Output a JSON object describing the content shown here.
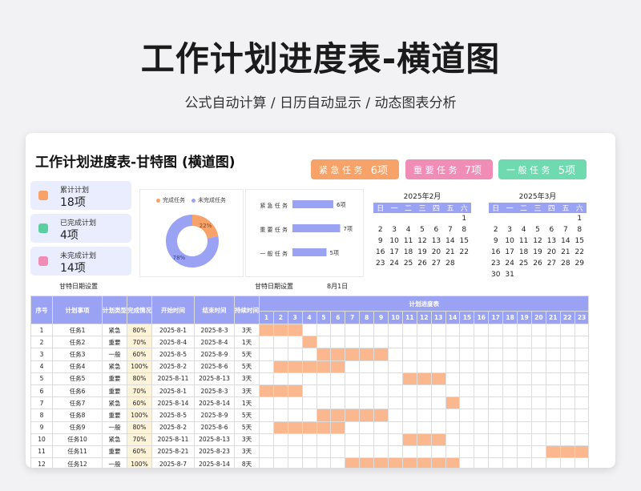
{
  "hero": {
    "title": "工作计划进度表-横道图",
    "subtitle": "公式自动计算 /  日历自动显示  /  动态图表分析"
  },
  "sheet": {
    "title": "工作计划进度表-甘特图 (横道图)"
  },
  "priority_pills": [
    {
      "label": "紧 急 任 务",
      "value": "6项",
      "color": "#f7a268"
    },
    {
      "label": "重 要 任 务",
      "value": "7项",
      "color": "#ef8db6"
    },
    {
      "label": "一 般 任 务",
      "value": "5项",
      "color": "#6fd9b0"
    }
  ],
  "stats": [
    {
      "label": "累计计划",
      "value": "18项",
      "icon": "calendar-icon",
      "color": "#f7a268"
    },
    {
      "label": "已完成计划",
      "value": "4项",
      "icon": "check-icon",
      "color": "#5ccfa0"
    },
    {
      "label": "未完成计划",
      "value": "14项",
      "icon": "pending-icon",
      "color": "#ef8db6"
    }
  ],
  "donut": {
    "legend": [
      "完成任务",
      "未完成任务"
    ],
    "colors": [
      "#f7a268",
      "#9aa2f4"
    ],
    "values": [
      22,
      78
    ],
    "labels": [
      "22%",
      "78%"
    ]
  },
  "bar_panel": {
    "categories": [
      "紧急任务",
      "重要任务",
      "一般任务"
    ],
    "category_labels": [
      "紧 急 任 务",
      "重 要 任 务",
      "一 般 任 务"
    ],
    "values": [
      6,
      7,
      5
    ],
    "value_labels": [
      "6项",
      "7项",
      "5项"
    ],
    "color": "#9aa2f4"
  },
  "calendars": [
    {
      "month": "2025年2月",
      "headers": [
        "日",
        "一",
        "二",
        "三",
        "四",
        "五",
        "六"
      ],
      "days": [
        "",
        "",
        "",
        "",
        "",
        "",
        "1",
        "2",
        "3",
        "4",
        "5",
        "6",
        "7",
        "8",
        "9",
        "10",
        "11",
        "12",
        "13",
        "14",
        "15",
        "16",
        "17",
        "18",
        "19",
        "20",
        "21",
        "22",
        "23",
        "24",
        "25",
        "26",
        "27",
        "28"
      ]
    },
    {
      "month": "2025年3月",
      "headers": [
        "日",
        "一",
        "二",
        "三",
        "四",
        "五",
        "六"
      ],
      "days": [
        "",
        "",
        "",
        "",
        "",
        "",
        "1",
        "2",
        "3",
        "4",
        "5",
        "6",
        "7",
        "8",
        "9",
        "10",
        "11",
        "12",
        "13",
        "14",
        "15",
        "16",
        "17",
        "18",
        "19",
        "20",
        "21",
        "22",
        "23",
        "24",
        "25",
        "26",
        "27",
        "28",
        "29",
        "30",
        "31"
      ]
    }
  ],
  "gantt_settings": {
    "left_label": "甘特日期设置",
    "right_label": "甘特日期设置",
    "right_value": "8月1日"
  },
  "table": {
    "headers": [
      "序号",
      "计划事项",
      "计划类型",
      "完成情况",
      "开始时间",
      "结束时间",
      "持续时间"
    ],
    "progress_header": "计划进度表",
    "days": [
      "1",
      "2",
      "3",
      "4",
      "5",
      "6",
      "7",
      "8",
      "9",
      "10",
      "11",
      "12",
      "13",
      "14",
      "15",
      "16",
      "17",
      "18",
      "19",
      "20",
      "21",
      "22",
      "23"
    ],
    "bar_color": "#fbb88f",
    "rows": [
      {
        "no": "1",
        "task": "任务1",
        "type": "紧急",
        "pct": "80%",
        "start": "2025-8-1",
        "end": "2025-8-3",
        "dur": "3天",
        "s": 1,
        "e": 3
      },
      {
        "no": "2",
        "task": "任务2",
        "type": "重要",
        "pct": "70%",
        "start": "2025-8-4",
        "end": "2025-8-4",
        "dur": "1天",
        "s": 4,
        "e": 4
      },
      {
        "no": "3",
        "task": "任务3",
        "type": "一般",
        "pct": "60%",
        "start": "2025-8-5",
        "end": "2025-8-9",
        "dur": "5天",
        "s": 5,
        "e": 9
      },
      {
        "no": "4",
        "task": "任务4",
        "type": "紧急",
        "pct": "100%",
        "start": "2025-8-2",
        "end": "2025-8-6",
        "dur": "5天",
        "s": 2,
        "e": 6
      },
      {
        "no": "5",
        "task": "任务5",
        "type": "重要",
        "pct": "80%",
        "start": "2025-8-11",
        "end": "2025-8-13",
        "dur": "3天",
        "s": 11,
        "e": 13
      },
      {
        "no": "6",
        "task": "任务6",
        "type": "重要",
        "pct": "70%",
        "start": "2025-8-1",
        "end": "2025-8-3",
        "dur": "3天",
        "s": 1,
        "e": 3
      },
      {
        "no": "7",
        "task": "任务7",
        "type": "紧急",
        "pct": "60%",
        "start": "2025-8-14",
        "end": "2025-8-14",
        "dur": "1天",
        "s": 14,
        "e": 14
      },
      {
        "no": "8",
        "task": "任务8",
        "type": "重要",
        "pct": "100%",
        "start": "2025-8-5",
        "end": "2025-8-9",
        "dur": "5天",
        "s": 5,
        "e": 9
      },
      {
        "no": "9",
        "task": "任务9",
        "type": "一般",
        "pct": "80%",
        "start": "2025-8-2",
        "end": "2025-8-6",
        "dur": "5天",
        "s": 2,
        "e": 6
      },
      {
        "no": "10",
        "task": "任务10",
        "type": "紧急",
        "pct": "70%",
        "start": "2025-8-11",
        "end": "2025-8-13",
        "dur": "3天",
        "s": 11,
        "e": 13
      },
      {
        "no": "11",
        "task": "任务11",
        "type": "重要",
        "pct": "60%",
        "start": "2025-8-21",
        "end": "2025-8-23",
        "dur": "3天",
        "s": 21,
        "e": 23
      },
      {
        "no": "12",
        "task": "任务12",
        "type": "一般",
        "pct": "100%",
        "start": "2025-8-7",
        "end": "2025-8-14",
        "dur": "8天",
        "s": 7,
        "e": 14
      }
    ]
  }
}
